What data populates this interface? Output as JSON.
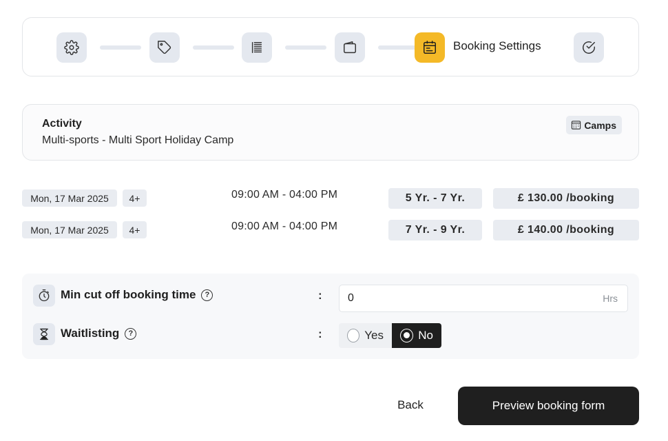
{
  "stepper": {
    "steps": [
      {
        "icon": "gear-icon",
        "active": false
      },
      {
        "icon": "tag-icon",
        "active": false
      },
      {
        "icon": "list-icon",
        "active": false
      },
      {
        "icon": "wallet-icon",
        "active": false
      },
      {
        "icon": "calendar-icon",
        "active": true,
        "label": "Booking Settings"
      },
      {
        "icon": "check-circle-icon",
        "active": false
      }
    ],
    "active_label": "Booking Settings",
    "accent_color": "#f4b927"
  },
  "activity": {
    "label": "Activity",
    "value": "Multi-sports - Multi Sport Holiday Camp",
    "badge": "Camps"
  },
  "sessions": [
    {
      "date": "Mon, 17 Mar 2025",
      "count": "4+",
      "time": "09:00 AM - 04:00 PM",
      "age": "5 Yr. - 7 Yr.",
      "price": "£ 130.00 /booking"
    },
    {
      "date": "Mon, 17 Mar 2025",
      "count": "4+",
      "time": "09:00 AM - 04:00 PM",
      "age": "7 Yr. - 9 Yr.",
      "price": "£ 140.00 /booking"
    }
  ],
  "settings": {
    "cutoff": {
      "label": "Min cut off booking time",
      "colon": ":",
      "value": "0",
      "unit": "Hrs"
    },
    "waitlisting": {
      "label": "Waitlisting",
      "colon": ":",
      "options": [
        "Yes",
        "No"
      ],
      "selected": "No"
    }
  },
  "footer": {
    "back_label": "Back",
    "preview_label": "Preview booking form"
  }
}
